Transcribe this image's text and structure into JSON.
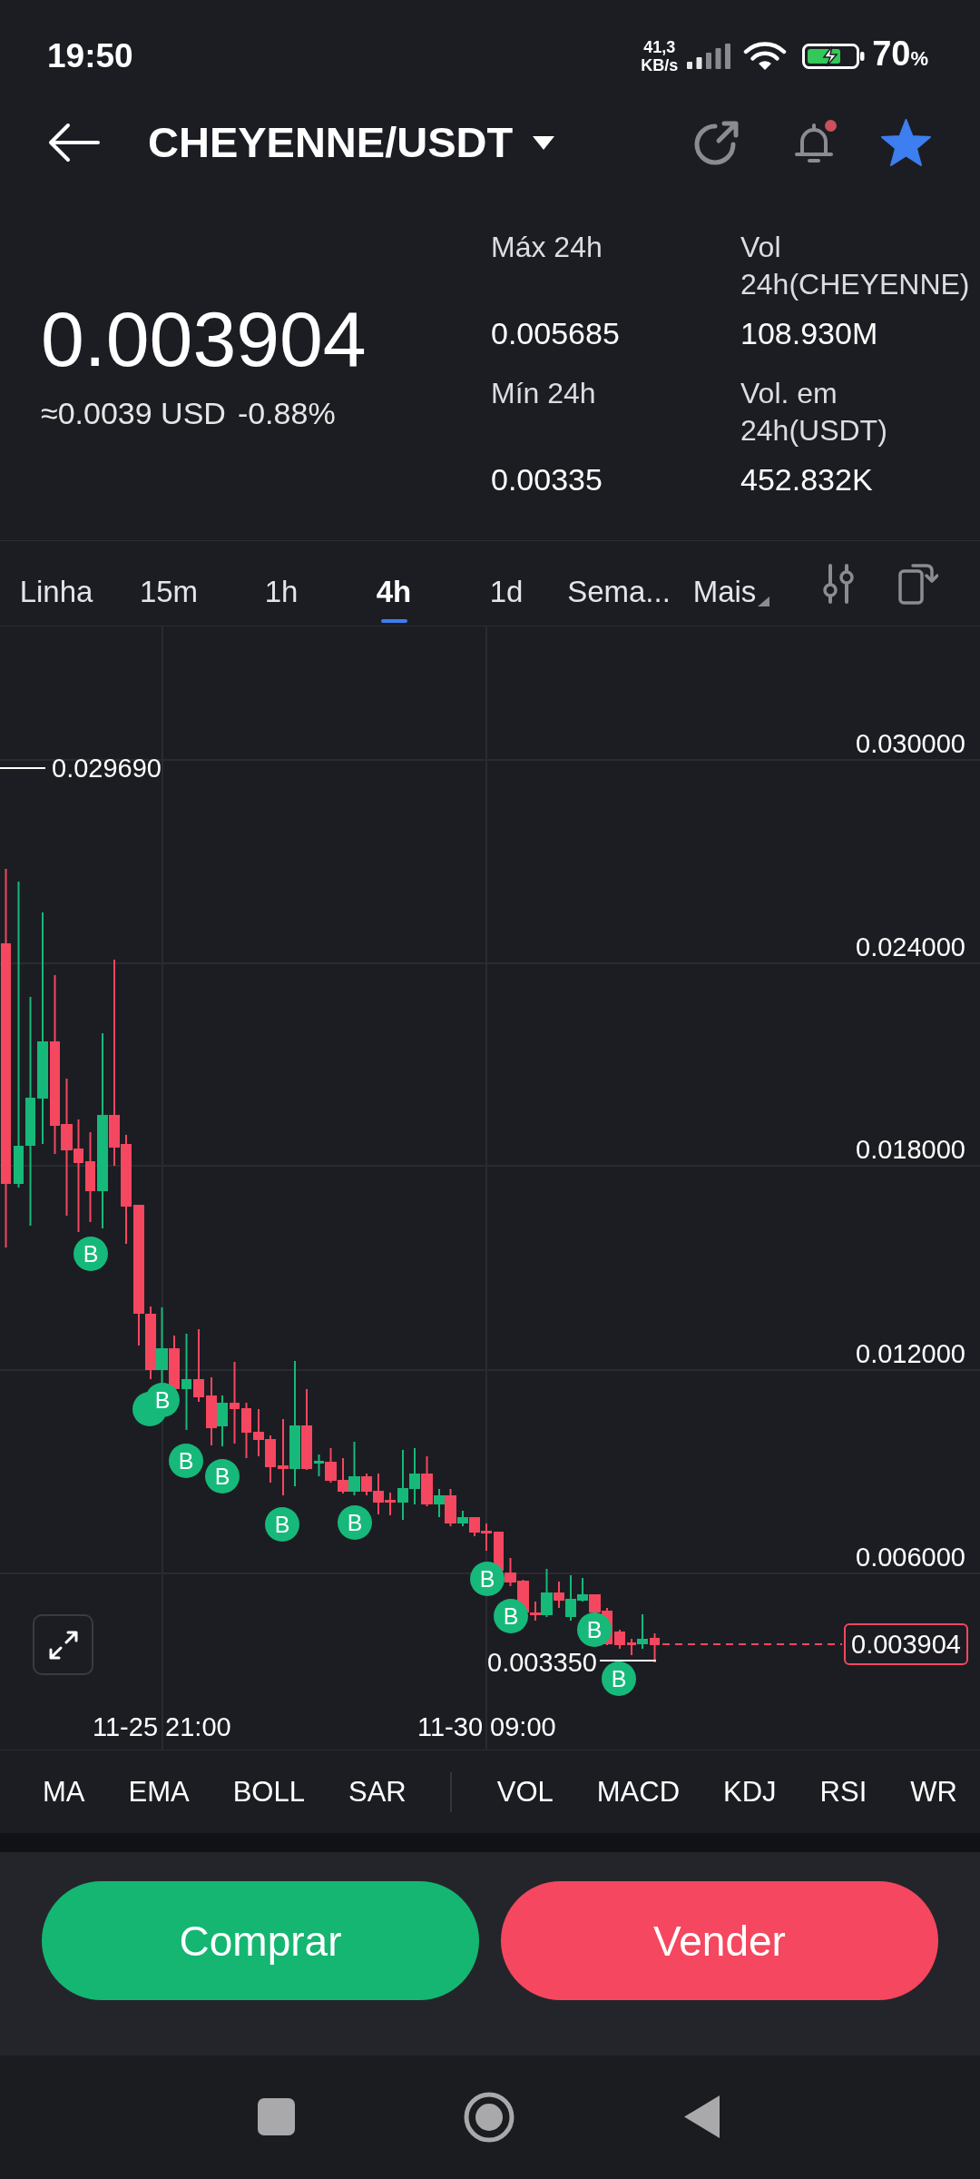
{
  "status_bar": {
    "time": "19:50",
    "net_speed": "41,3",
    "net_speed_unit": "KB/s",
    "battery": "70",
    "battery_unit": "%"
  },
  "header": {
    "title": "CHEYENNE/USDT",
    "notification_dot": true,
    "favorite": true
  },
  "ticker": {
    "price": "0.003904",
    "fiat_price": "≈0.0039 USD",
    "change": "-0.88%",
    "stats": [
      {
        "label": "Máx 24h",
        "value": "0.005685"
      },
      {
        "label": "Vol 24h(CHEYENNE)",
        "value": "108.930M"
      },
      {
        "label": "Mín 24h",
        "value": "0.00335"
      },
      {
        "label": "Vol. em 24h(USDT)",
        "value": "452.832K"
      }
    ]
  },
  "tabs": [
    {
      "label": "Linha",
      "selected": false,
      "has_menu": false
    },
    {
      "label": "15m",
      "selected": false,
      "has_menu": false
    },
    {
      "label": "1h",
      "selected": false,
      "has_menu": false
    },
    {
      "label": "4h",
      "selected": true,
      "has_menu": false
    },
    {
      "label": "1d",
      "selected": false,
      "has_menu": false
    },
    {
      "label": "Sema...",
      "selected": false,
      "has_menu": false
    },
    {
      "label": "Mais",
      "selected": false,
      "has_menu": true
    }
  ],
  "chart": {
    "y_labels": [
      "0.030000",
      "0.024000",
      "0.018000",
      "0.012000",
      "0.006000"
    ],
    "x_labels": [
      "11-25 21:00",
      "11-30 09:00"
    ],
    "high_label": "0.029690",
    "low_label": "0.003350",
    "last_price": "0.003904",
    "markers": [
      {
        "label": "B"
      },
      {
        "label": "B"
      },
      {
        "label": "B"
      },
      {
        "label": "B"
      },
      {
        "label": "B"
      },
      {
        "label": "B"
      },
      {
        "label": "B"
      },
      {
        "label": "B"
      },
      {
        "label": "B"
      },
      {
        "label": "B"
      }
    ]
  },
  "indicators": {
    "main": [
      "MA",
      "EMA",
      "BOLL",
      "SAR"
    ],
    "sub": [
      "VOL",
      "MACD",
      "KDJ",
      "RSI",
      "WR"
    ]
  },
  "actions": [
    {
      "label": "Comprar",
      "kind": "buy"
    },
    {
      "label": "Vender",
      "kind": "sell"
    }
  ]
}
